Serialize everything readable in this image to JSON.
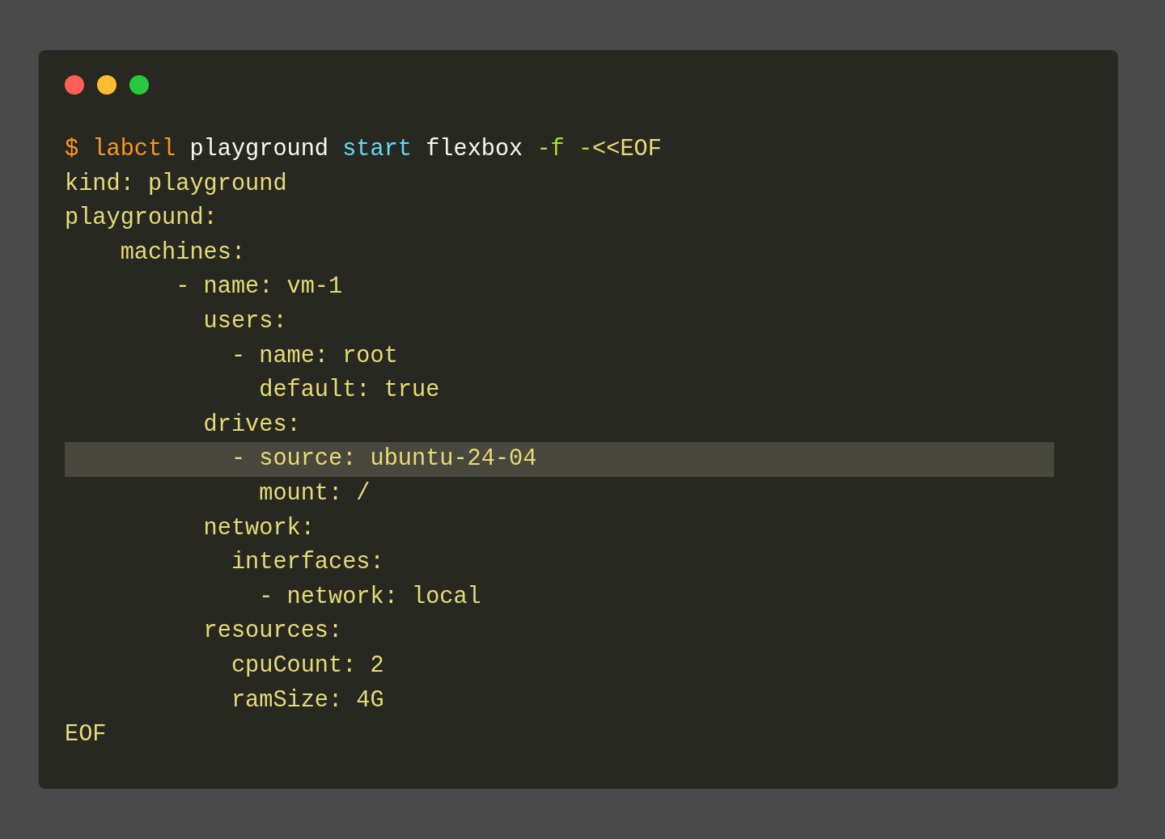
{
  "window": {
    "controls": [
      {
        "color": "#ff5f56"
      },
      {
        "color": "#ffbd2e"
      },
      {
        "color": "#27c93f"
      }
    ]
  },
  "lines": [
    {
      "highlighted": false,
      "tokens": [
        {
          "kind": "command",
          "text": "$ labctl"
        },
        {
          "kind": "plain",
          "text": " playground"
        },
        {
          "kind": "keyword",
          "text": " start"
        },
        {
          "kind": "plain",
          "text": " flexbox"
        },
        {
          "kind": "flag",
          "text": " -f"
        },
        {
          "kind": "flag",
          "text": " -"
        },
        {
          "kind": "string",
          "text": "<<EOF"
        }
      ]
    },
    {
      "highlighted": false,
      "tokens": [
        {
          "kind": "string",
          "text": "kind: playground"
        }
      ]
    },
    {
      "highlighted": false,
      "tokens": [
        {
          "kind": "string",
          "text": "playground:"
        }
      ]
    },
    {
      "highlighted": false,
      "tokens": [
        {
          "kind": "string",
          "text": "    machines:"
        }
      ]
    },
    {
      "highlighted": false,
      "tokens": [
        {
          "kind": "string",
          "text": "        - name: vm-1"
        }
      ]
    },
    {
      "highlighted": false,
      "tokens": [
        {
          "kind": "string",
          "text": "          users:"
        }
      ]
    },
    {
      "highlighted": false,
      "tokens": [
        {
          "kind": "string",
          "text": "            - name: root"
        }
      ]
    },
    {
      "highlighted": false,
      "tokens": [
        {
          "kind": "string",
          "text": "              default: true"
        }
      ]
    },
    {
      "highlighted": false,
      "tokens": [
        {
          "kind": "string",
          "text": "          drives:"
        }
      ]
    },
    {
      "highlighted": true,
      "tokens": [
        {
          "kind": "string",
          "text": "            - source: ubuntu-24-04"
        }
      ]
    },
    {
      "highlighted": false,
      "tokens": [
        {
          "kind": "string",
          "text": "              mount: /"
        }
      ]
    },
    {
      "highlighted": false,
      "tokens": [
        {
          "kind": "string",
          "text": "          network:"
        }
      ]
    },
    {
      "highlighted": false,
      "tokens": [
        {
          "kind": "string",
          "text": "            interfaces:"
        }
      ]
    },
    {
      "highlighted": false,
      "tokens": [
        {
          "kind": "string",
          "text": "              - network: local"
        }
      ]
    },
    {
      "highlighted": false,
      "tokens": [
        {
          "kind": "string",
          "text": "          resources:"
        }
      ]
    },
    {
      "highlighted": false,
      "tokens": [
        {
          "kind": "string",
          "text": "            cpuCount: 2"
        }
      ]
    },
    {
      "highlighted": false,
      "tokens": [
        {
          "kind": "string",
          "text": "            ramSize: 4G"
        }
      ]
    },
    {
      "highlighted": false,
      "tokens": [
        {
          "kind": "string",
          "text": "EOF"
        }
      ]
    }
  ]
}
